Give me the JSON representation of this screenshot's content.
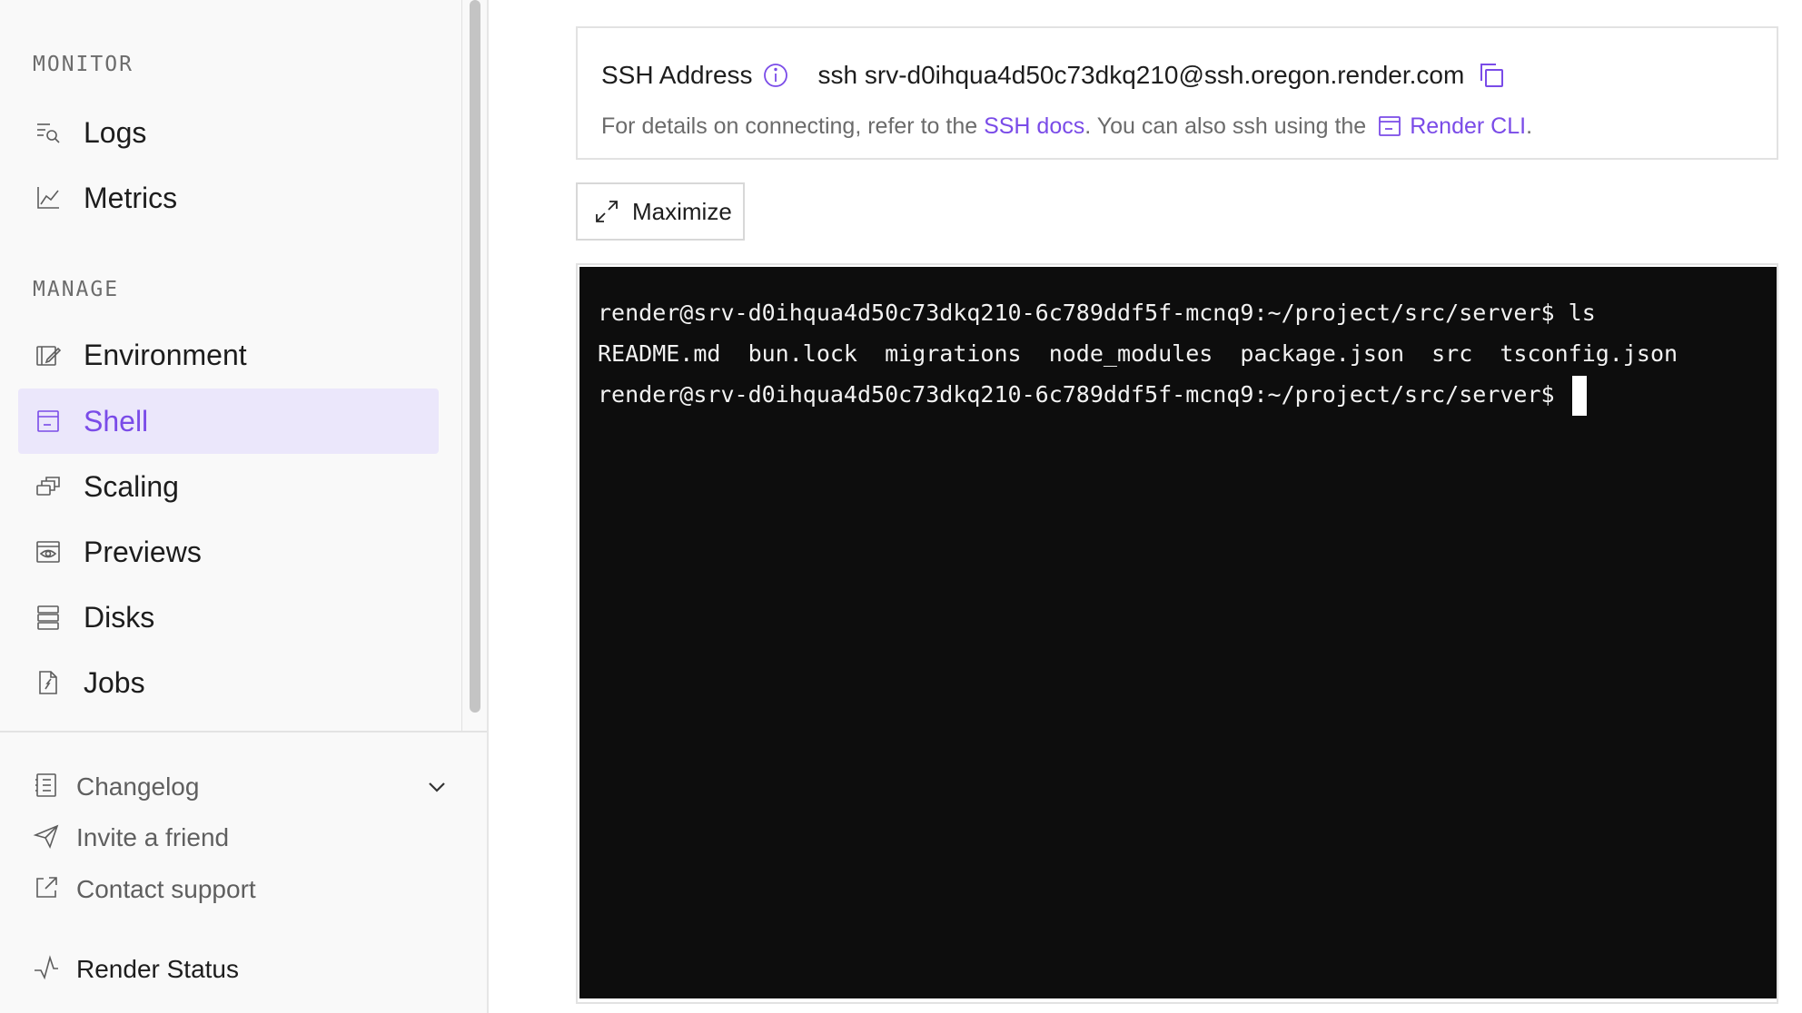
{
  "sidebar": {
    "sections": [
      {
        "title": "MONITOR",
        "items": [
          {
            "label": "Logs",
            "icon": "logs-icon"
          },
          {
            "label": "Metrics",
            "icon": "metrics-icon"
          }
        ]
      },
      {
        "title": "MANAGE",
        "items": [
          {
            "label": "Environment",
            "icon": "environment-icon"
          },
          {
            "label": "Shell",
            "icon": "shell-icon",
            "active": true
          },
          {
            "label": "Scaling",
            "icon": "scaling-icon"
          },
          {
            "label": "Previews",
            "icon": "previews-icon"
          },
          {
            "label": "Disks",
            "icon": "disks-icon"
          },
          {
            "label": "Jobs",
            "icon": "jobs-icon"
          }
        ]
      }
    ],
    "footer": {
      "changelog": "Changelog",
      "invite": "Invite a friend",
      "support": "Contact support",
      "status": "Render Status"
    }
  },
  "ssh": {
    "label": "SSH Address",
    "command": "ssh srv-d0ihqua4d50c73dkq210@ssh.oregon.render.com",
    "details_prefix": "For details on connecting, refer to the ",
    "docs_link": "SSH docs",
    "details_middle": ". You can also ssh using the ",
    "cli_link": "Render CLI",
    "details_suffix": "."
  },
  "maximize": {
    "label": "Maximize"
  },
  "terminal": {
    "lines": [
      "render@srv-d0ihqua4d50c73dkq210-6c789ddf5f-mcnq9:~/project/src/server$ ls",
      "README.md  bun.lock  migrations  node_modules  package.json  src  tsconfig.json",
      "render@srv-d0ihqua4d50c73dkq210-6c789ddf5f-mcnq9:~/project/src/server$ "
    ]
  },
  "colors": {
    "accent": "#7a4be8",
    "active_bg": "#ebe7fb",
    "terminal_bg": "#0d0d0d",
    "sidebar_bg": "#f9f9f9"
  }
}
